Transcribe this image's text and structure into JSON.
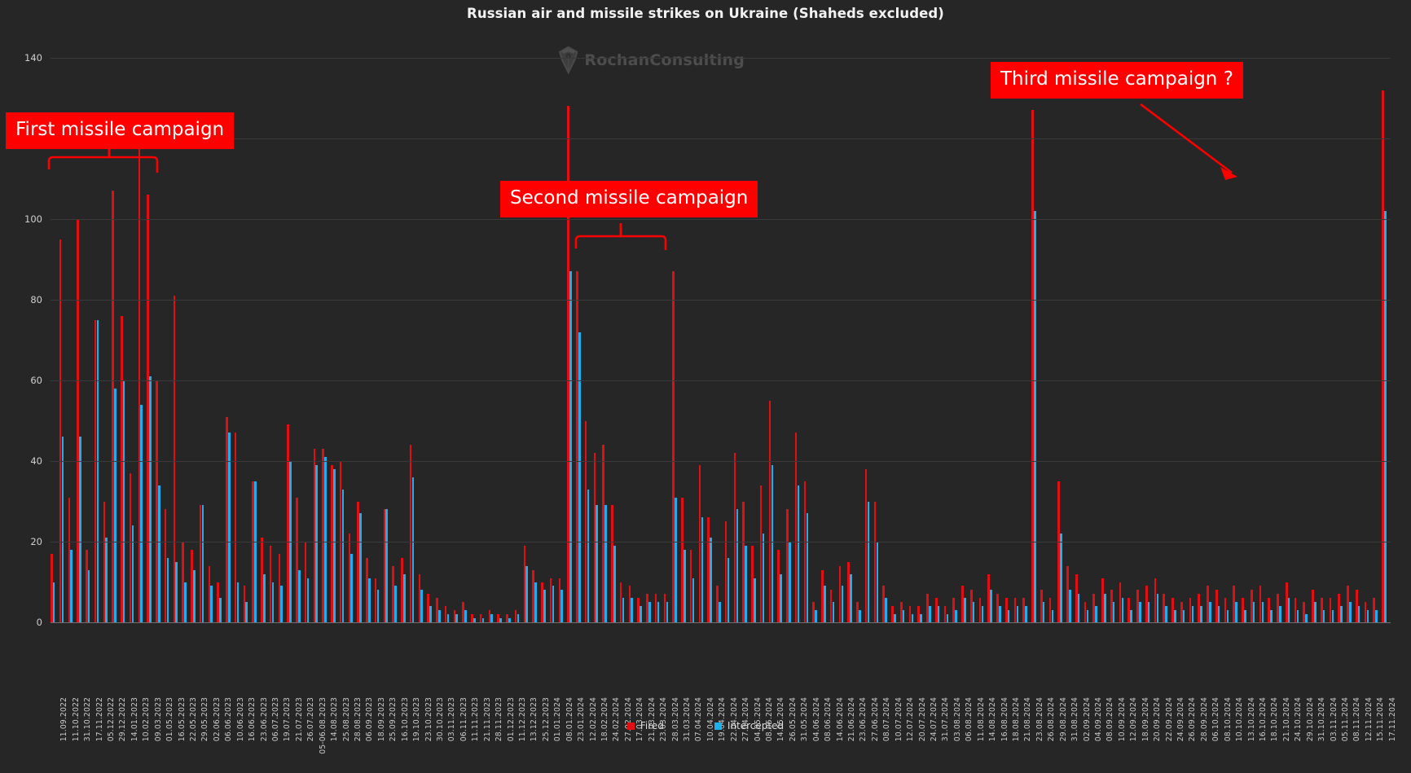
{
  "chart_data": {
    "type": "bar",
    "title": "Russian air and missile strikes on Ukraine (Shaheds excluded)",
    "xlabel": "",
    "ylabel": "",
    "ylim": [
      0,
      140
    ],
    "yticks": [
      0,
      20,
      40,
      60,
      80,
      100,
      120,
      140
    ],
    "ytick_labels": [
      "0",
      "20",
      "40",
      "60",
      "80",
      "100",
      "",
      "140"
    ],
    "grid": true,
    "legend_position": "bottom",
    "legend": [
      "Fired",
      "Intercepted"
    ],
    "colors": {
      "fired": "#e10f14",
      "intercepted": "#1cb0ee",
      "background": "#262626",
      "grid": "#3a3a3a",
      "callout": "#ff0000",
      "text": "#e6e6e6"
    },
    "series": [
      {
        "name": "Fired",
        "color": "#e10f14",
        "values": [
          17,
          95,
          31,
          100,
          18,
          75,
          30,
          107,
          76,
          37,
          124,
          106,
          60,
          28,
          81,
          20,
          18,
          29,
          14,
          10,
          51,
          47,
          9,
          35,
          21,
          19,
          17,
          49,
          31,
          20,
          43,
          43,
          39,
          40,
          22,
          30,
          16,
          11,
          28,
          14,
          16,
          44,
          12,
          7,
          6,
          4,
          3,
          5,
          2,
          2,
          3,
          2,
          2,
          3,
          19,
          13,
          10,
          11,
          11,
          128,
          87,
          50,
          42,
          44,
          29,
          10,
          9,
          6,
          7,
          7,
          7,
          87,
          31,
          18,
          39,
          26,
          9,
          25,
          42,
          30,
          19,
          34,
          55,
          18,
          28,
          47,
          35,
          5,
          13,
          8,
          14,
          15,
          5,
          38,
          30,
          9,
          4,
          5,
          4,
          4,
          7,
          6,
          4,
          6,
          9,
          8,
          6,
          12,
          7,
          6,
          6,
          6,
          127,
          8,
          6,
          35,
          14,
          12,
          5,
          7,
          11,
          8,
          10,
          6,
          8,
          9,
          11,
          7,
          6,
          5,
          6,
          7,
          9,
          8,
          6,
          9,
          6,
          8,
          9,
          6,
          7,
          10,
          6,
          5,
          8,
          6,
          6,
          7,
          9,
          8,
          5,
          6,
          132
        ]
      },
      {
        "name": "Intercepted",
        "color": "#1cb0ee",
        "values": [
          10,
          46,
          18,
          46,
          13,
          75,
          21,
          58,
          60,
          24,
          54,
          61,
          34,
          16,
          15,
          10,
          13,
          29,
          9,
          6,
          47,
          10,
          5,
          35,
          12,
          10,
          9,
          40,
          13,
          11,
          39,
          41,
          38,
          33,
          17,
          27,
          11,
          8,
          28,
          9,
          12,
          36,
          8,
          4,
          3,
          2,
          2,
          3,
          1,
          1,
          2,
          1,
          1,
          2,
          14,
          10,
          8,
          9,
          8,
          87,
          72,
          33,
          29,
          29,
          19,
          6,
          6,
          4,
          5,
          5,
          5,
          31,
          18,
          11,
          26,
          21,
          5,
          16,
          28,
          19,
          11,
          22,
          39,
          12,
          20,
          34,
          27,
          3,
          9,
          5,
          9,
          12,
          3,
          30,
          20,
          6,
          2,
          3,
          2,
          2,
          4,
          4,
          2,
          3,
          6,
          5,
          4,
          8,
          4,
          3,
          4,
          4,
          102,
          5,
          3,
          22,
          8,
          7,
          3,
          4,
          7,
          5,
          6,
          3,
          5,
          5,
          7,
          4,
          3,
          3,
          4,
          4,
          5,
          4,
          3,
          5,
          3,
          5,
          5,
          3,
          4,
          6,
          3,
          2,
          5,
          3,
          3,
          4,
          5,
          4,
          3,
          3,
          102
        ]
      }
    ],
    "categories": [
      "11.09.2022",
      "11.10.2022",
      "31.10.2022",
      "17.11.2022",
      "05.12.2022",
      "29.12.2022",
      "14.01.2023",
      "10.02.2023",
      "09.03.2023",
      "01.05.2023",
      "16.05.2023",
      "22.05.2023",
      "29.05.2023",
      "02.06.2023",
      "06.06.2023",
      "10.06.2023",
      "16.06.2023",
      "23.06.2023",
      "06.07.2023",
      "19.07.2023",
      "21.07.2023",
      "26.07.2023",
      "05-06.08.2023",
      "14.08.2023",
      "25.08.2023",
      "28.08.2023",
      "06.09.2023",
      "18.09.2023",
      "25.09.2023",
      "16.10.2023",
      "19.10.2023",
      "23.10.2023",
      "30.10.2023",
      "03.11.2023",
      "06.11.2023",
      "11.11.2023",
      "21.11.2023",
      "28.11.2023",
      "01.12.2023",
      "11.12.2023",
      "13.12.2023",
      "25.12.2023",
      "01.01.2024",
      "08.01.2024",
      "23.01.2024",
      "12.02.2024",
      "18.02.2024",
      "24.02.2024",
      "27.02.2024",
      "17.03.2024",
      "21.03.2024",
      "23.03.2024",
      "28.03.2024",
      "31.03.2024",
      "07.04.2024",
      "10.04.2024",
      "19.04.2024",
      "22.04.2024",
      "27.04.2024",
      "04.05.2024",
      "08.05.2024",
      "14.05.2024",
      "26.05.2024",
      "31.05.2024",
      "04.06.2024",
      "08.06.2024",
      "14.06.2024",
      "21.06.2024",
      "23.06.2024",
      "27.06.2024",
      "08.07.2024",
      "10.07.2024",
      "12.07.2024",
      "20.07.2024",
      "24.07.2024",
      "31.07.2024",
      "03.08.2024",
      "06.08.2024",
      "11.08.2024",
      "14.08.2024",
      "16.08.2024",
      "18.08.2024",
      "21.08.2024",
      "23.08.2024",
      "26.08.2024",
      "29.08.2024",
      "31.08.2024",
      "02.09.2024",
      "04.09.2024",
      "08.09.2024",
      "10.09.2024",
      "12.09.2024",
      "18.09.2024",
      "20.09.2024",
      "22.09.2024",
      "24.09.2024",
      "26.09.2024",
      "28.09.2024",
      "06.10.2024",
      "08.10.2024",
      "10.10.2024",
      "13.10.2024",
      "16.10.2024",
      "18.10.2024",
      "21.10.2024",
      "24.10.2024",
      "29.10.2024",
      "31.10.2024",
      "03.11.2024",
      "05.11.2024",
      "08.11.2024",
      "12.11.2024",
      "15.11.2024",
      "17.11.2024"
    ],
    "annotations": [
      {
        "id": "first",
        "text": "First missile campaign",
        "style": "red-box-with-brace"
      },
      {
        "id": "second",
        "text": "Second missile campaign",
        "style": "red-box-with-brace"
      },
      {
        "id": "third",
        "text": "Third missile campaign ?",
        "style": "red-box-with-arrow"
      }
    ]
  },
  "watermark": {
    "text": "RochanConsulting",
    "icon": "pen-nib-logo"
  },
  "legend": {
    "items": [
      {
        "label": "Fired",
        "color": "#e10f14"
      },
      {
        "label": "Intercepted",
        "color": "#1cb0ee"
      }
    ]
  },
  "annotations": {
    "first": "First missile campaign",
    "second": "Second missile campaign",
    "third": "Third missile campaign ?"
  }
}
